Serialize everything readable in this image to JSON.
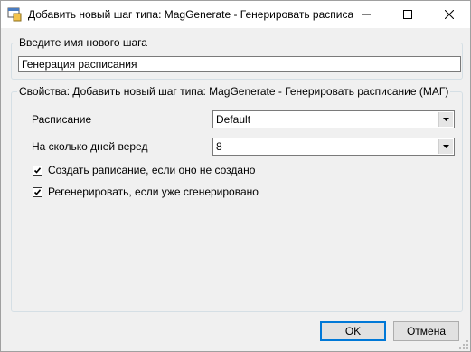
{
  "window": {
    "title": "Добавить новый шаг типа: MagGenerate - Генерировать расписание (МАГ)"
  },
  "icons": {
    "app": "app-window-icon",
    "minimize": "minimize-icon",
    "maximize": "maximize-icon",
    "close": "close-icon",
    "dropdown": "chevron-down-icon",
    "check": "checkmark-icon",
    "grip": "resize-grip-icon"
  },
  "name_group": {
    "label": "Введите имя нового шага",
    "value": "Генерация расписания"
  },
  "props_group": {
    "label": "Свойства: Добавить новый шаг типа: MagGenerate - Генерировать расписание (МАГ)",
    "schedule_label": "Расписание",
    "schedule_value": "Default",
    "days_label": "На сколько дней веред",
    "days_value": "8",
    "create_checkbox": {
      "label": "Создать раписание, если оно не создано",
      "checked": true
    },
    "regen_checkbox": {
      "label": "Регенерировать, если уже сгенерировано",
      "checked": true
    }
  },
  "buttons": {
    "ok": "OK",
    "cancel": "Отмена"
  },
  "colors": {
    "window_bg": "#f0f0f0",
    "accent": "#0078d7"
  }
}
